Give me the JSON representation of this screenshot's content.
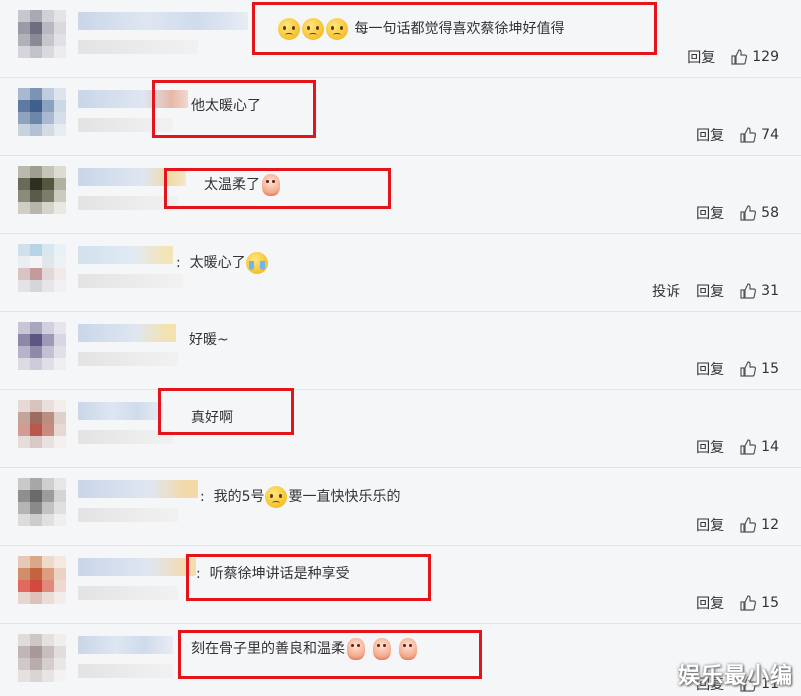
{
  "actions": {
    "reply_label": "回复",
    "report_label": "投诉"
  },
  "comments": [
    {
      "text": "每一句话都觉得喜欢蔡徐坤好值得",
      "likes": "129",
      "highlighted": true
    },
    {
      "text": "他太暖心了",
      "likes": "74",
      "highlighted": true
    },
    {
      "text": "太温柔了",
      "likes": "58",
      "highlighted": true
    },
    {
      "text": "太暖心了",
      "likes": "31",
      "highlighted": false
    },
    {
      "text": "好暖~",
      "likes": "15",
      "highlighted": false
    },
    {
      "text": "真好啊",
      "likes": "14",
      "highlighted": true
    },
    {
      "text_before": "我的5号",
      "text_after": "要一直快快乐乐的",
      "likes": "12",
      "highlighted": false
    },
    {
      "text": "听蔡徐坤讲话是种享受",
      "likes": "15",
      "highlighted": true
    },
    {
      "text": "刻在骨子里的善良和温柔",
      "likes": "11",
      "highlighted": true
    }
  ],
  "watermark": "娱乐最小编",
  "colors": {
    "highlight_box": "#e5141b",
    "background": "#f5f6f8",
    "divider": "#e4e4e4"
  }
}
